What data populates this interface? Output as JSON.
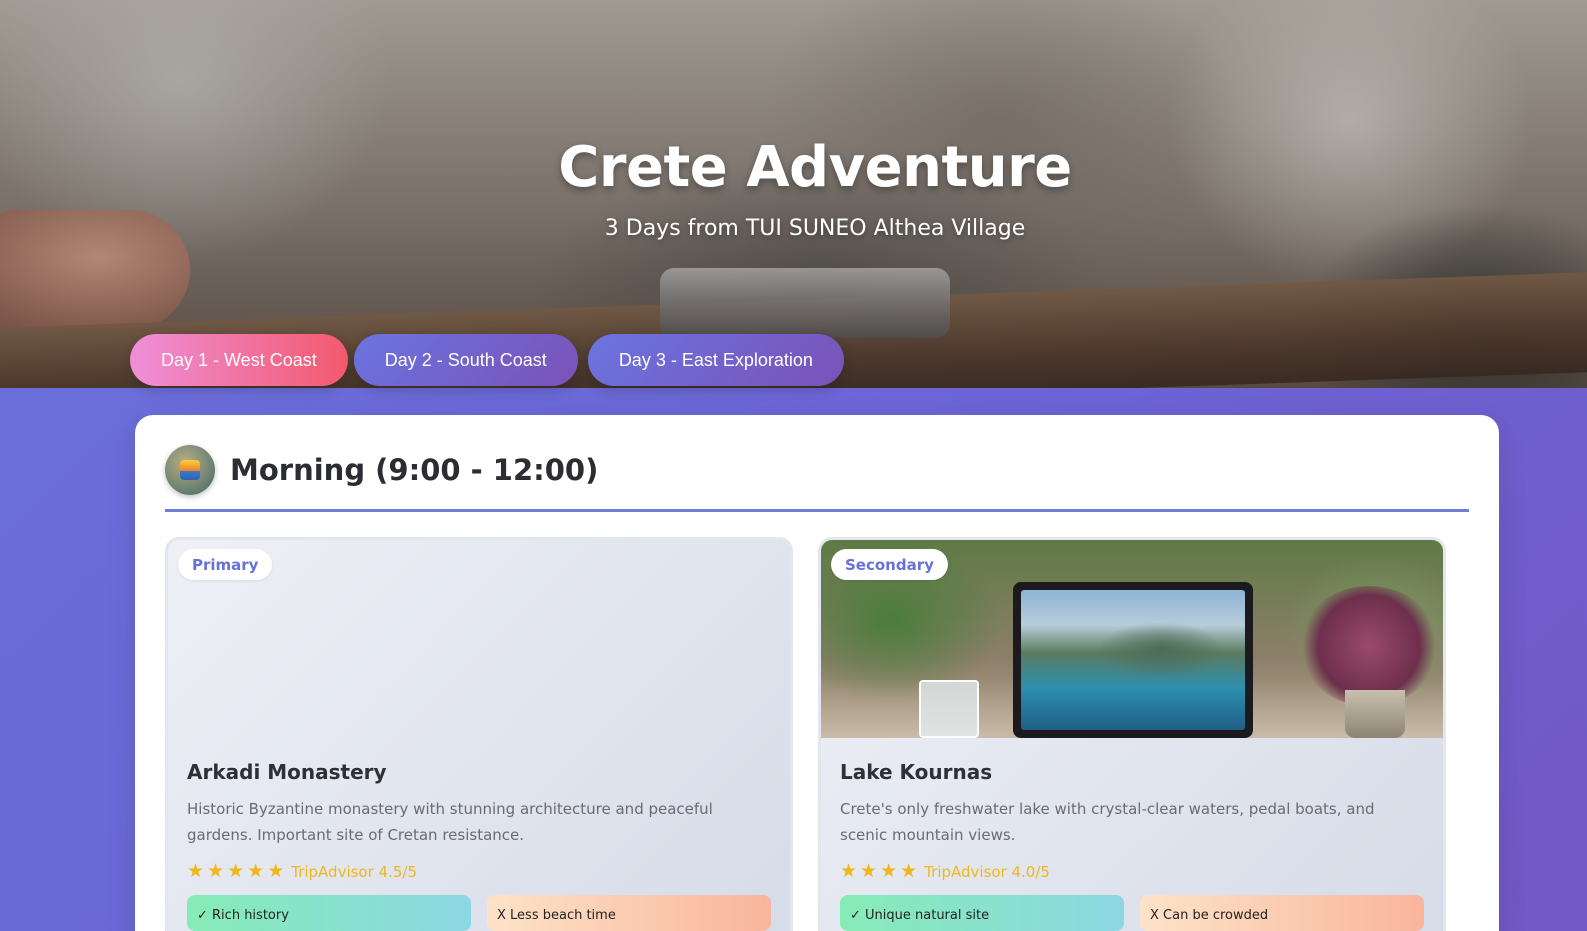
{
  "hero": {
    "title": "Crete Adventure",
    "subtitle": "3 Days from TUI SUNEO Althea Village"
  },
  "day_tabs": [
    {
      "label": "Day 1 - West Coast",
      "active": true
    },
    {
      "label": "Day 2 - South Coast",
      "active": false
    },
    {
      "label": "Day 3 - East Exploration",
      "active": false
    }
  ],
  "period": {
    "title": "Morning (9:00 - 12:00)",
    "icon": "sunrise-icon"
  },
  "options": [
    {
      "badge": "Primary",
      "name": "Arkadi Monastery",
      "description": "Historic Byzantine monastery with stunning architecture and peaceful gardens. Important site of Cretan resistance.",
      "stars": 5,
      "rating_text": "TripAdvisor 4.5/5",
      "pro": "✓ Rich history",
      "con": "X  Less beach time"
    },
    {
      "badge": "Secondary",
      "name": "Lake Kournas",
      "description": "Crete's only freshwater lake with crystal-clear waters, pedal boats, and scenic mountain views.",
      "stars": 4,
      "rating_text": "TripAdvisor 4.0/5",
      "pro": "✓ Unique natural site",
      "con": "X  Can be crowded"
    }
  ],
  "colors": {
    "accent": "#6e7fd8",
    "active_tab_start": "#ef8fd9",
    "active_tab_end": "#f3596d",
    "star": "#f0b718"
  }
}
